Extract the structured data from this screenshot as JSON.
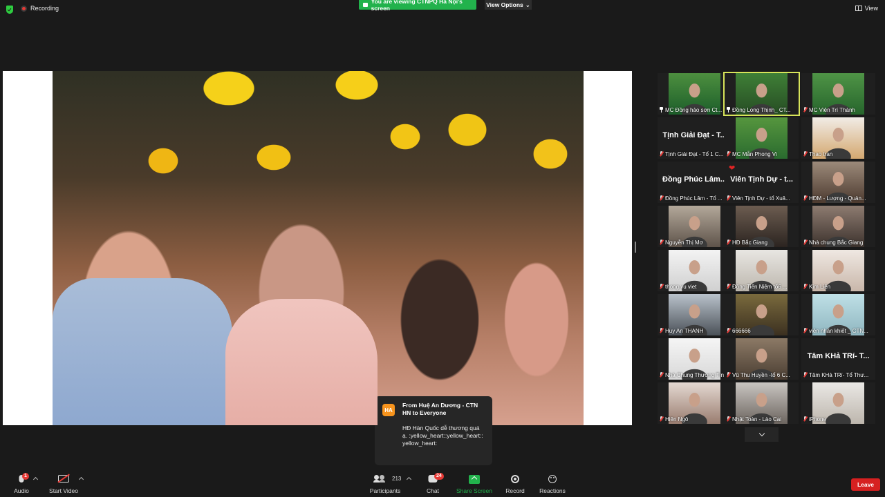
{
  "topbar": {
    "recording": "Recording",
    "viewing_banner": "You are viewing CTNPQ Hà Nội's screen",
    "view_options": "View Options",
    "view": "View"
  },
  "gallery": [
    {
      "name": "MC Đồng hảo sơn Ct...",
      "type": "video",
      "pinned": true,
      "colors": [
        "#4d8f3f",
        "#1c5e2a"
      ]
    },
    {
      "name": "Đồng Long Thịnh_ CT...",
      "type": "video",
      "pinned": true,
      "active": true,
      "colors": [
        "#3f7f36",
        "#264d24"
      ]
    },
    {
      "name": "MC Viên Trí Thành",
      "type": "video",
      "colors": [
        "#4f9446",
        "#26652c"
      ]
    },
    {
      "name": "Tịnh Giải Đạt - Tổ 1 C...",
      "type": "name",
      "display": "Tịnh Giải Đạt - T..."
    },
    {
      "name": "MC Mẫn Phong Vi",
      "type": "video",
      "colors": [
        "#56963e",
        "#2a6b2f"
      ]
    },
    {
      "name": "Thao tran",
      "type": "video",
      "colors": [
        "#f1ece6",
        "#d4a870"
      ]
    },
    {
      "name": "Đồng Phúc Lâm - Tổ ...",
      "type": "name",
      "display": "Đồng Phúc Lâm..."
    },
    {
      "name": "Viên Tịnh Dự - tổ Xuâ...",
      "type": "name",
      "display": "Viên Tịnh Dự - t...",
      "heart": "❤"
    },
    {
      "name": "HĐM - Lượng - Quản...",
      "type": "video",
      "colors": [
        "#9c8a7a",
        "#4d3b30"
      ]
    },
    {
      "name": "Nguyễn Thị Mơ",
      "type": "video",
      "colors": [
        "#b3a89a",
        "#5e534a"
      ]
    },
    {
      "name": "HĐ Bắc Giang",
      "type": "video",
      "colors": [
        "#6c5c50",
        "#2b2420"
      ]
    },
    {
      "name": "Nhà chung Bắc Giang",
      "type": "video",
      "colors": [
        "#8d7b70",
        "#3c322d"
      ]
    },
    {
      "name": "thong vu viet",
      "type": "video",
      "colors": [
        "#f3f3f3",
        "#d0d0d0"
      ]
    },
    {
      "name": "Đồng Tiến Niệm tổ6 ...",
      "type": "video",
      "colors": [
        "#e8e6e2",
        "#bdb7ae"
      ]
    },
    {
      "name": "Kim Liên",
      "type": "video",
      "colors": [
        "#efe8e2",
        "#c9b7aa"
      ]
    },
    {
      "name": "Huy An THANH",
      "type": "video",
      "colors": [
        "#b9c2cb",
        "#4b5158"
      ]
    },
    {
      "name": "666666",
      "type": "video",
      "colors": [
        "#7a6a3d",
        "#3b3020"
      ]
    },
    {
      "name": "viên nhãn khiết _ CTN...",
      "type": "video",
      "colors": [
        "#bfe0e6",
        "#8fb6c0"
      ]
    },
    {
      "name": "Nhà Chung Thương Tín",
      "type": "video",
      "colors": [
        "#f5f5f5",
        "#d8d8d8"
      ]
    },
    {
      "name": "Vũ Thu Huyền -tổ 6 C...",
      "type": "video",
      "colors": [
        "#8c7a66",
        "#4a3d32"
      ]
    },
    {
      "name": "Tâm KHả TRí- Tổ Thư...",
      "type": "name",
      "display": "Tâm KHả TRí- T..."
    },
    {
      "name": "Hiên Ngô",
      "type": "video",
      "colors": [
        "#e4d9d2",
        "#9a7d70"
      ]
    },
    {
      "name": "Nhật Toàn - Lào Cai",
      "type": "video",
      "colors": [
        "#c9c5c1",
        "#6d6660"
      ]
    },
    {
      "name": "iPhone",
      "type": "video",
      "colors": [
        "#eae8e5",
        "#bdb6ad"
      ]
    }
  ],
  "chat_popup": {
    "avatar": "HA",
    "from": "From Huệ An Dương - CTN HN to Everyone",
    "message": "HĐ Hàn Quốc dễ thương quá ạ. :yellow_heart::yellow_heart::yellow_heart:"
  },
  "toolbar": {
    "audio": "Audio",
    "audio_badge": "1",
    "start_video": "Start Video",
    "participants": "Participants",
    "participant_count": "213",
    "chat": "Chat",
    "chat_badge": "24",
    "share_screen": "Share Screen",
    "record": "Record",
    "reactions": "Reactions",
    "leave": "Leave"
  },
  "colors": {
    "accent_green": "#22b24c",
    "leave_red": "#d62020",
    "active_speaker": "#d7e45a"
  }
}
